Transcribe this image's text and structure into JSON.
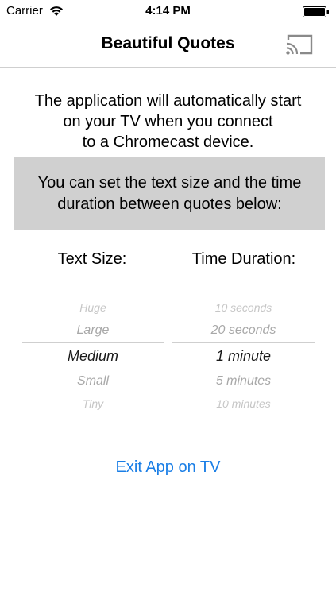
{
  "status_bar": {
    "carrier": "Carrier",
    "time": "4:14 PM"
  },
  "nav": {
    "title": "Beautiful Quotes"
  },
  "intro": {
    "text": "The application will automatically start\non your TV when you connect\nto a Chromecast device."
  },
  "info_box": {
    "text": "You can set the text size and the time\nduration between quotes below:"
  },
  "text_size": {
    "header": "Text Size:",
    "options": [
      "Huge",
      "Large",
      "Medium",
      "Small",
      "Tiny"
    ],
    "selected": "Medium"
  },
  "time_duration": {
    "header": "Time Duration:",
    "options": [
      "10 seconds",
      "20 seconds",
      "1 minute",
      "5 minutes",
      "10 minutes"
    ],
    "selected": "1 minute"
  },
  "exit_button": {
    "label": "Exit App on TV"
  },
  "colors": {
    "accent": "#1a7ee6",
    "info_box_bg": "#d0d0d0",
    "divider": "#cfcfcf"
  },
  "icons": {
    "wifi": "wifi-icon",
    "battery": "battery-icon",
    "cast": "cast-icon"
  }
}
